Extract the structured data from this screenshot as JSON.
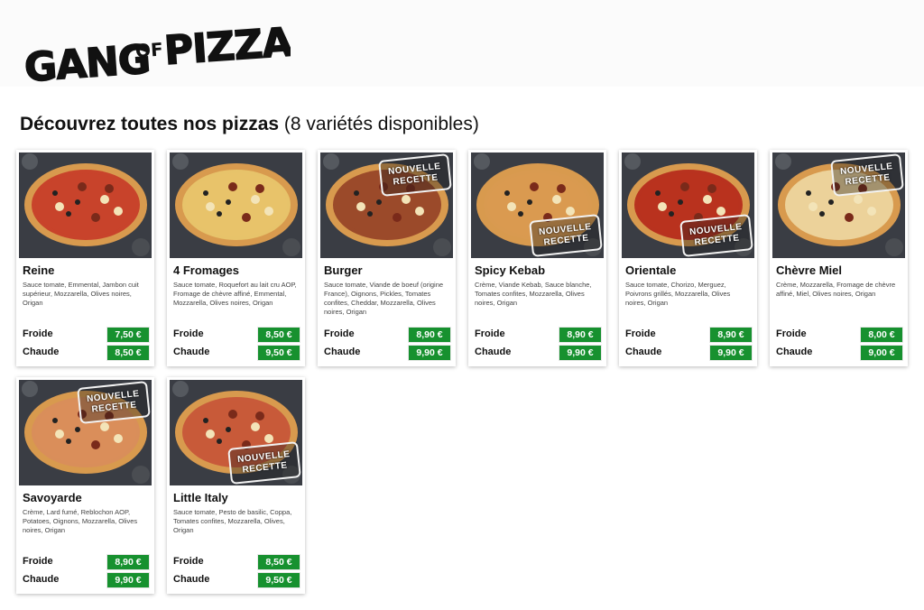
{
  "brand": {
    "logo_text": "GANG OF PIZZA"
  },
  "heading": {
    "strong": "Découvrez toutes nos pizzas",
    "light": " (8 variétés disponibles)"
  },
  "labels": {
    "froide": "Froide",
    "chaude": "Chaude",
    "badge_line1": "NOUVELLE",
    "badge_line2": "RECETTE"
  },
  "colors": {
    "price_bg": "#17912f",
    "price_text": "#ffffff"
  },
  "pizzas": [
    {
      "name": "Reine",
      "desc": "Sauce tomate, Emmental, Jambon cuit supérieur, Mozzarella, Olives noires, Origan",
      "froide": "7,50 €",
      "chaude": "8,50 €",
      "badge": "none"
    },
    {
      "name": "4 Fromages",
      "desc": "Sauce tomate, Roquefort au lait cru AOP, Fromage de chèvre affiné, Emmental, Mozzarella, Olives noires, Origan",
      "froide": "8,50 €",
      "chaude": "9,50 €",
      "badge": "none"
    },
    {
      "name": "Burger",
      "desc": "Sauce tomate, Viande de boeuf (origine France), Oignons, Pickles, Tomates confites, Cheddar, Mozzarella, Olives noires, Origan",
      "froide": "8,90 €",
      "chaude": "9,90 €",
      "badge": "top"
    },
    {
      "name": "Spicy Kebab",
      "desc": "Crème, Viande Kebab, Sauce blanche, Tomates confites, Mozzarella, Olives noires, Origan",
      "froide": "8,90 €",
      "chaude": "9,90 €",
      "badge": "bottom"
    },
    {
      "name": "Orientale",
      "desc": "Sauce tomate, Chorizo, Merguez, Poivrons grillés, Mozzarella, Olives noires, Origan",
      "froide": "8,90 €",
      "chaude": "9,90 €",
      "badge": "bottom"
    },
    {
      "name": "Chèvre Miel",
      "desc": "Crème, Mozzarella, Fromage de chèvre affiné, Miel, Olives noires, Origan",
      "froide": "8,00 €",
      "chaude": "9,00 €",
      "badge": "top"
    },
    {
      "name": "Savoyarde",
      "desc": "Crème, Lard fumé, Reblochon AOP, Potatoes, Oignons, Mozzarella, Olives noires, Origan",
      "froide": "8,90 €",
      "chaude": "9,90 €",
      "badge": "top"
    },
    {
      "name": "Little Italy",
      "desc": "Sauce tomate, Pesto de basilic, Coppa, Tomates confites, Mozzarella, Olives, Origan",
      "froide": "8,50 €",
      "chaude": "9,50 €",
      "badge": "bottom"
    }
  ]
}
